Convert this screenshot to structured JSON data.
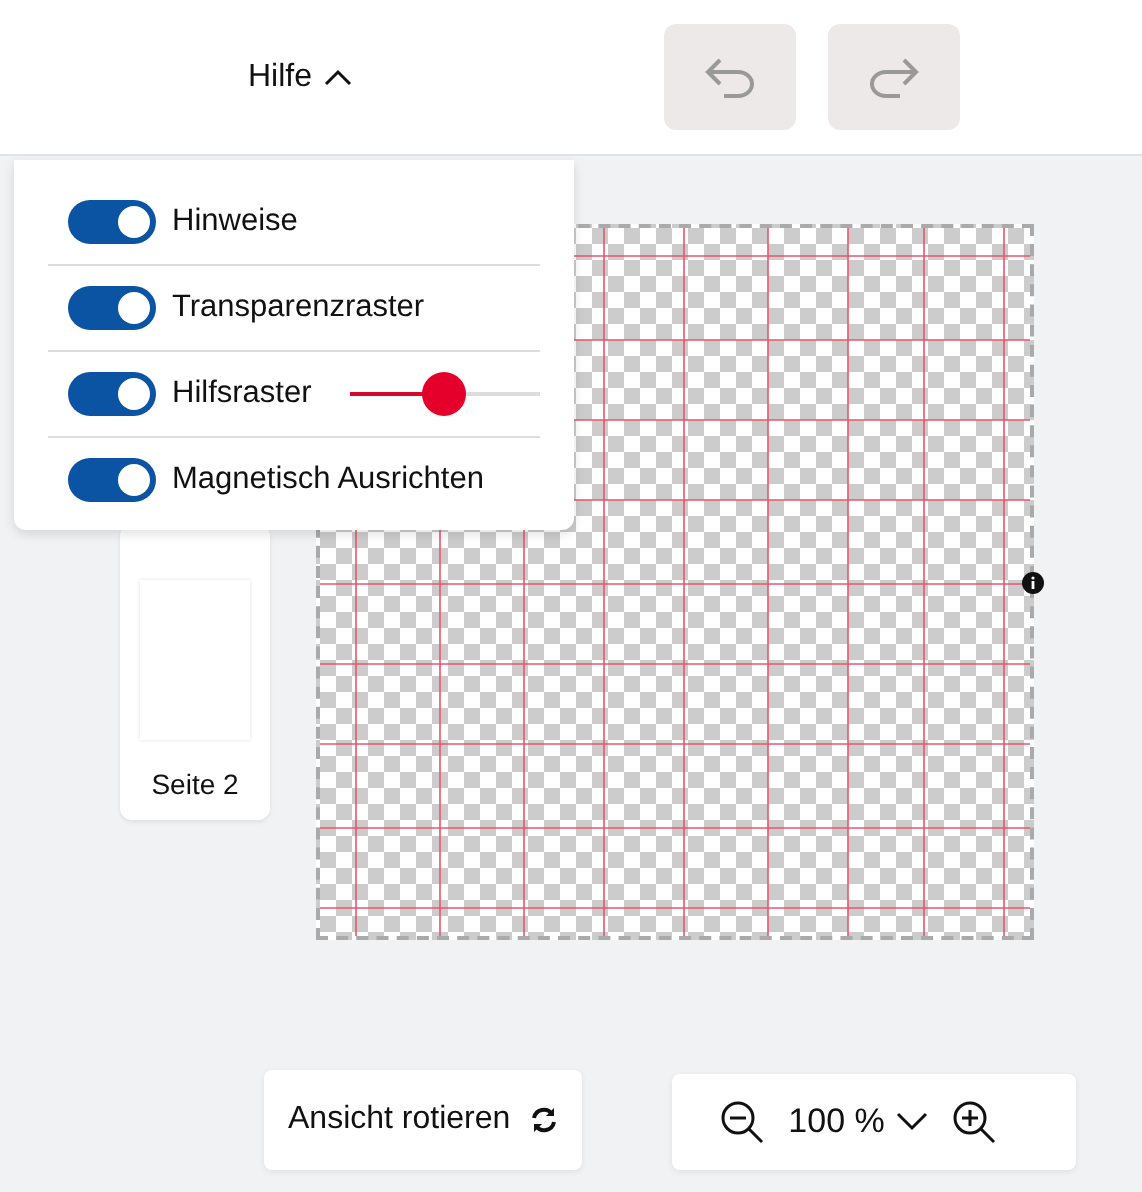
{
  "header": {
    "help_menu": {
      "label": "Hilfe",
      "expanded": true
    },
    "undo": {
      "disabled": true
    },
    "redo": {
      "disabled": true
    }
  },
  "help_dropdown": {
    "items": [
      {
        "kind": "toggle",
        "label": "Hinweise",
        "on": true
      },
      {
        "kind": "toggle",
        "label": "Transparenzraster",
        "on": true
      },
      {
        "kind": "toggle_slider",
        "label": "Hilfsraster",
        "on": true,
        "level": 0.5
      },
      {
        "kind": "toggle",
        "label": "Magnetisch Ausrichten",
        "on": true
      }
    ]
  },
  "pages": [
    {
      "label": "Seite 2"
    }
  ],
  "canvas": {
    "transparency_grid": true,
    "guides": true
  },
  "bottom_bar": {
    "rotate_button": "Ansicht rotieren",
    "zoom": "100 %"
  }
}
